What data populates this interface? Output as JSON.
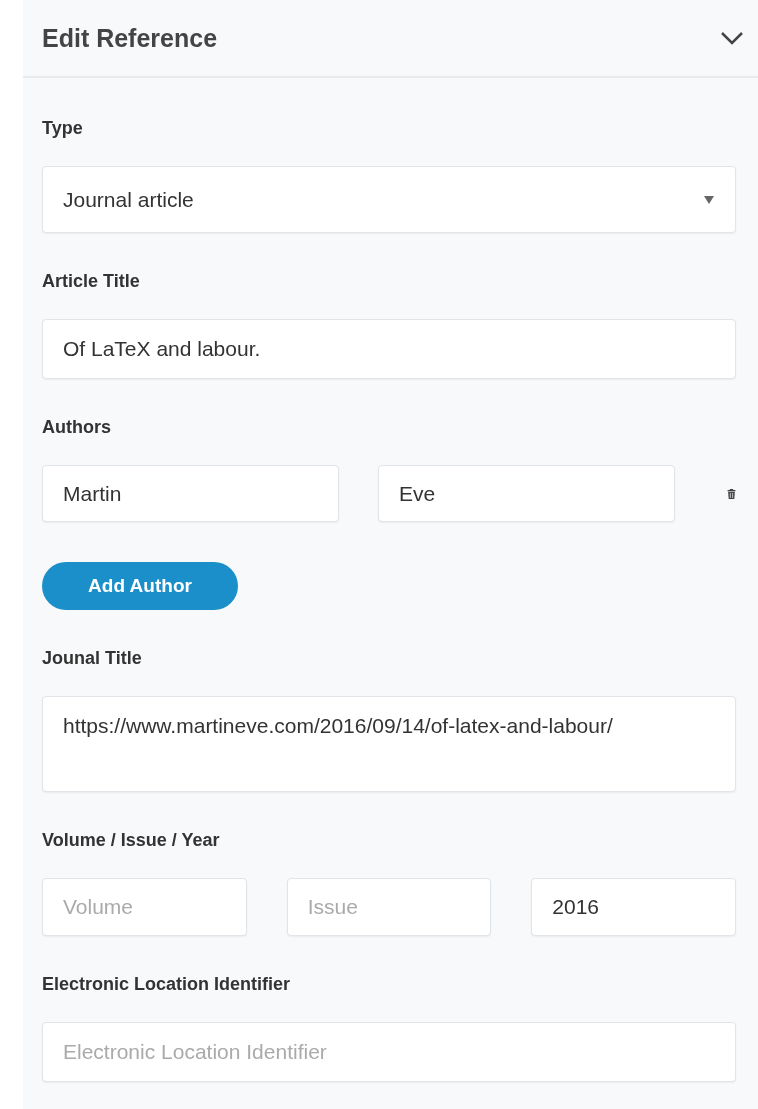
{
  "panel": {
    "title": "Edit Reference",
    "expanded": true
  },
  "fields": [
    {
      "kind": "select",
      "label": "Type",
      "value": "Journal article"
    },
    {
      "kind": "text",
      "label": "Article Title",
      "value": "Of LaTeX and labour."
    },
    {
      "kind": "authors",
      "label": "Authors",
      "authors": [
        {
          "first": "Martin",
          "last": "Eve"
        }
      ],
      "add_button": "Add Author"
    },
    {
      "kind": "textarea",
      "label": "Jounal Title",
      "value": "https://www.martineve.com/2016/09/14/of-latex-and-labour/"
    },
    {
      "kind": "group",
      "label": "Volume / Issue / Year",
      "inputs": [
        {
          "placeholder": "Volume"
        },
        {
          "placeholder": "Issue"
        },
        {
          "value": "2016"
        }
      ]
    },
    {
      "kind": "text",
      "label": "Electronic Location Identifier",
      "placeholder": "Electronic Location Identifier"
    }
  ]
}
